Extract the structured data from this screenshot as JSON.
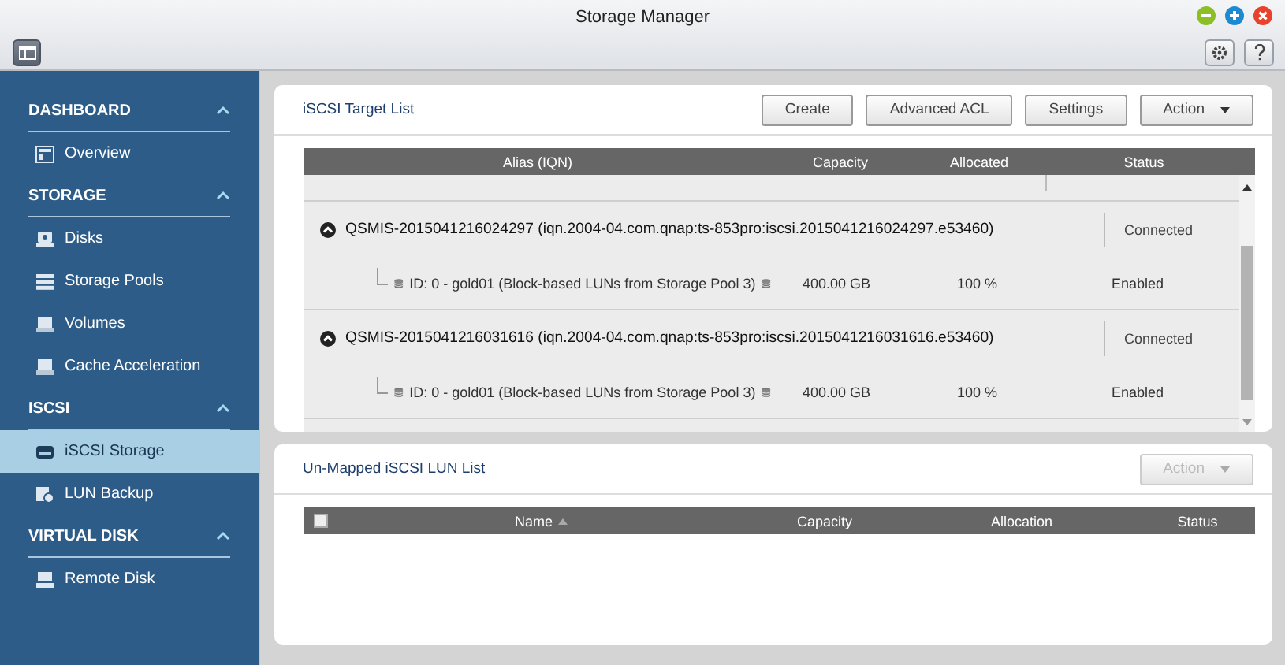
{
  "window": {
    "title": "Storage Manager"
  },
  "sidebar": {
    "sections": [
      {
        "title": "DASHBOARD",
        "expanded": true,
        "items": [
          {
            "label": "Overview",
            "selected": false
          }
        ]
      },
      {
        "title": "STORAGE",
        "expanded": true,
        "items": [
          {
            "label": "Disks",
            "selected": false
          },
          {
            "label": "Storage Pools",
            "selected": false
          },
          {
            "label": "Volumes",
            "selected": false
          },
          {
            "label": "Cache Acceleration",
            "selected": false
          }
        ]
      },
      {
        "title": "ISCSI",
        "expanded": true,
        "items": [
          {
            "label": "iSCSI Storage",
            "selected": true
          },
          {
            "label": "LUN Backup",
            "selected": false
          }
        ]
      },
      {
        "title": "VIRTUAL DISK",
        "expanded": true,
        "items": [
          {
            "label": "Remote Disk",
            "selected": false
          }
        ]
      }
    ]
  },
  "target_panel": {
    "title": "iSCSI Target List",
    "buttons": [
      {
        "label": "Create",
        "kind": "plain",
        "disabled": false
      },
      {
        "label": "Advanced ACL",
        "kind": "plain",
        "disabled": false
      },
      {
        "label": "Settings",
        "kind": "plain",
        "disabled": false
      },
      {
        "label": "Action",
        "kind": "dropdown",
        "disabled": false
      }
    ],
    "table": {
      "columns": [
        "Alias (IQN)",
        "Capacity",
        "Allocated",
        "Status"
      ],
      "targets": [
        {
          "name": "QSMIS-2015041216024297 (iqn.2004-04.com.qnap:ts-853pro:iscsi.2015041216024297.e53460)",
          "expanded": true,
          "status": "Connected",
          "luns": [
            {
              "name": "ID: 0 - gold01 (Block-based LUNs from Storage Pool 3)",
              "capacity": "400.00 GB",
              "allocated": "100 %",
              "status": "Enabled"
            }
          ]
        },
        {
          "name": "QSMIS-2015041216031616 (iqn.2004-04.com.qnap:ts-853pro:iscsi.2015041216031616.e53460)",
          "expanded": true,
          "status": "Connected",
          "luns": [
            {
              "name": "ID: 0 - gold01 (Block-based LUNs from Storage Pool 3)",
              "capacity": "400.00 GB",
              "allocated": "100 %",
              "status": "Enabled"
            }
          ]
        }
      ]
    }
  },
  "lun_panel": {
    "title": "Un-Mapped iSCSI LUN List",
    "buttons": [
      {
        "label": "Action",
        "kind": "dropdown",
        "disabled": true
      }
    ],
    "table": {
      "select_all_checked": false,
      "columns": [
        {
          "label": "Name",
          "sorted": true
        },
        {
          "label": "Capacity",
          "sorted": false
        },
        {
          "label": "Allocation",
          "sorted": false
        },
        {
          "label": "Status",
          "sorted": false
        }
      ]
    }
  }
}
